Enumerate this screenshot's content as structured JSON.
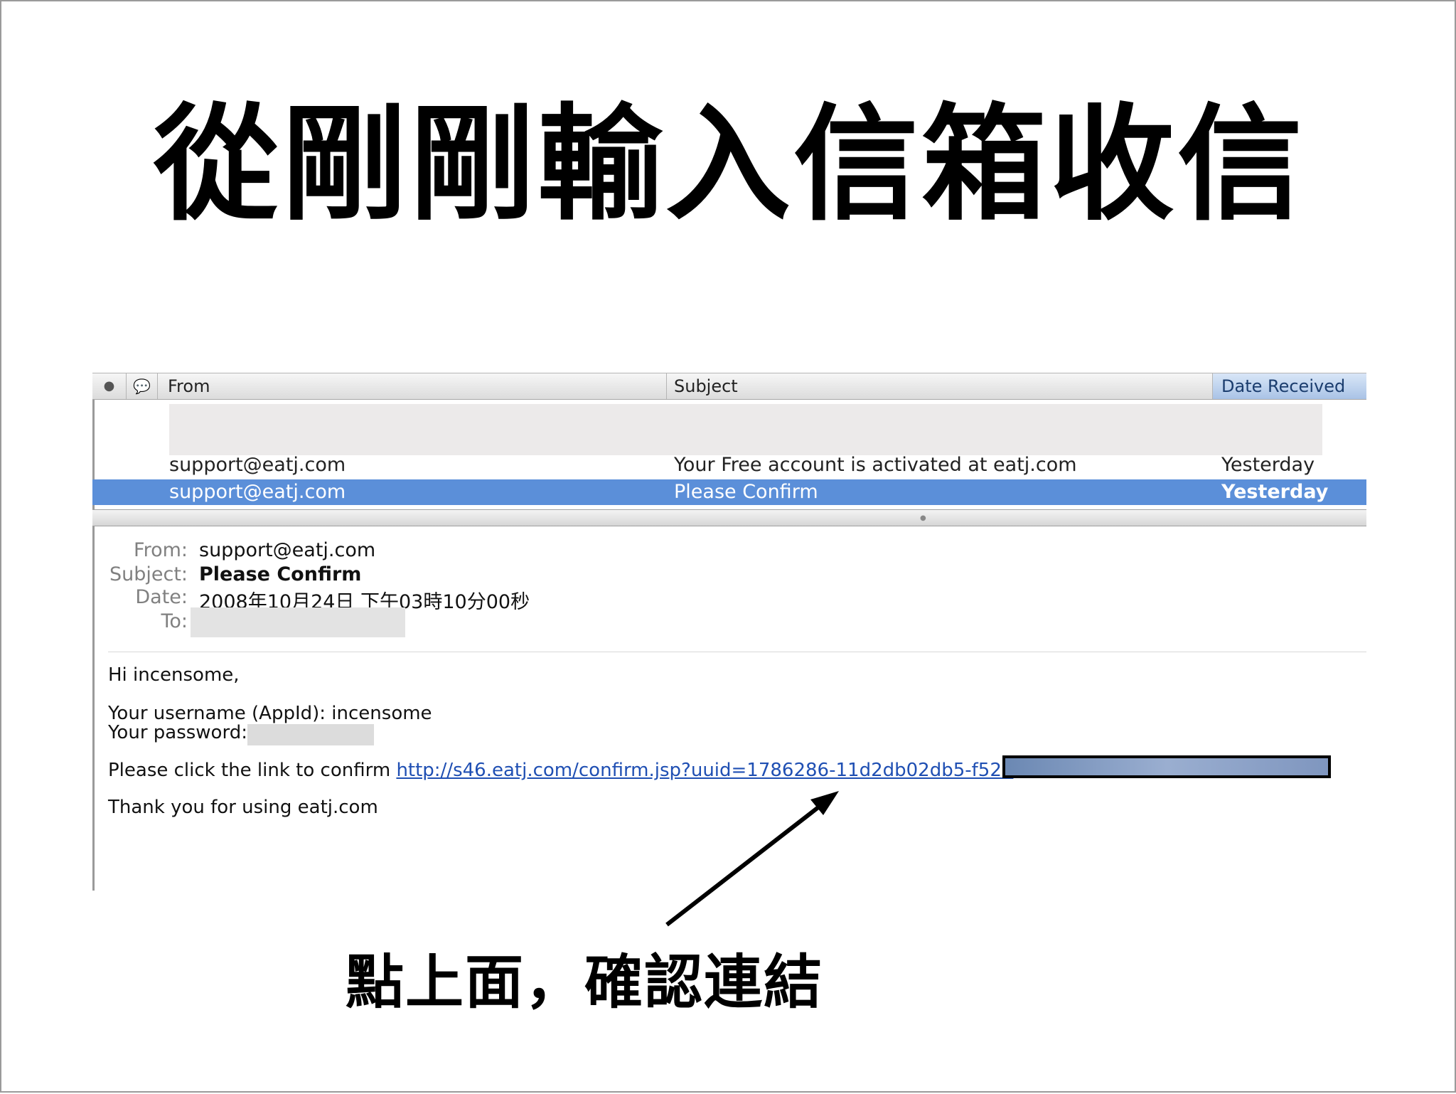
{
  "slide": {
    "title": "從剛剛輸入信箱收信",
    "caption": "點上面，確認連結"
  },
  "mail_list": {
    "columns": {
      "status_icon": "●",
      "attachment_icon": "💬",
      "from": "From",
      "subject": "Subject",
      "date": "Date Received"
    },
    "rows": [
      {
        "from": "support@eatj.com",
        "subject": "Your Free account is activated at eatj.com",
        "date": "Yesterday",
        "selected": false
      },
      {
        "from": "support@eatj.com",
        "subject": "Please Confirm",
        "date": "Yesterday",
        "selected": true
      }
    ],
    "selection_color": "#5b8fd9"
  },
  "message": {
    "labels": {
      "from": "From:",
      "subject": "Subject:",
      "date": "Date:",
      "to": "To:"
    },
    "from": "support@eatj.com",
    "subject": "Please Confirm",
    "date": "2008年10月24日 下午03時10分00秒",
    "greeting": "Hi incensome,",
    "username_line": "Your username (AppId): incensome",
    "password_label": "Your password:",
    "confirm_prefix": "Please click the link to confirm ",
    "confirm_link": "http://s46.eatj.com/confirm.jsp?uuid=1786286-11d2db02db5-f528",
    "thanks": "Thank you for using eatj.com",
    "link_color": "#1f4fb3"
  }
}
